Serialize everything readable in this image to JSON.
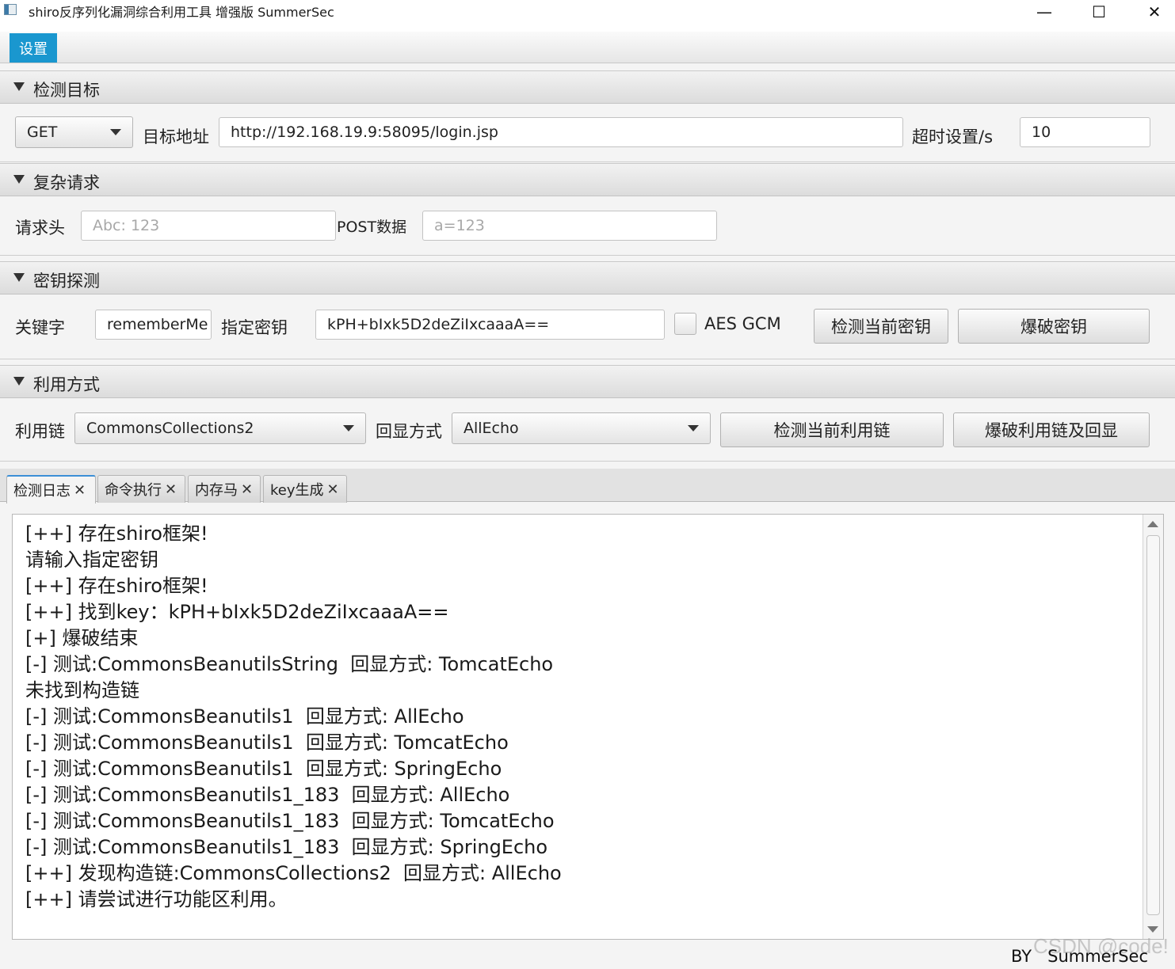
{
  "window": {
    "title": "shiro反序列化漏洞综合利用工具 增强版 SummerSec",
    "min_glyph": "—",
    "max_glyph": "☐",
    "close_glyph": "✕"
  },
  "menu": {
    "settings": "设置"
  },
  "target": {
    "title": "检测目标",
    "method": "GET",
    "url_label": "目标地址",
    "url": "http://192.168.19.9:58095/login.jsp",
    "timeout_label": "超时设置/s",
    "timeout": "10"
  },
  "complex": {
    "title": "复杂请求",
    "header_label": "请求头",
    "header_placeholder": "Abc: 123",
    "post_label": "POST数据",
    "post_placeholder": "a=123"
  },
  "key": {
    "title": "密钥探测",
    "keyword_label": "关键字",
    "keyword": "rememberMe",
    "specified_label": "指定密钥",
    "specified": "kPH+bIxk5D2deZiIxcaaaA==",
    "aes_gcm_label": "AES GCM",
    "check_button": "检测当前密钥",
    "brute_button": "爆破密钥"
  },
  "exploit": {
    "title": "利用方式",
    "chain_label": "利用链",
    "chain": "CommonsCollections2",
    "echo_label": "回显方式",
    "echo": "AllEcho",
    "check_button": "检测当前利用链",
    "brute_button": "爆破利用链及回显"
  },
  "tabs": [
    "检测日志",
    "命令执行",
    "内存马",
    "key生成"
  ],
  "tab_close": "✕",
  "log": [
    "[++] 存在shiro框架!",
    "请输入指定密钥",
    "[++] 存在shiro框架!",
    "[++] 找到key：kPH+bIxk5D2deZiIxcaaaA==",
    "[+] 爆破结束",
    "[-] 测试:CommonsBeanutilsString  回显方式: TomcatEcho",
    "未找到构造链",
    "[-] 测试:CommonsBeanutils1  回显方式: AllEcho",
    "[-] 测试:CommonsBeanutils1  回显方式: TomcatEcho",
    "[-] 测试:CommonsBeanutils1  回显方式: SpringEcho",
    "[-] 测试:CommonsBeanutils1_183  回显方式: AllEcho",
    "[-] 测试:CommonsBeanutils1_183  回显方式: TomcatEcho",
    "[-] 测试:CommonsBeanutils1_183  回显方式: SpringEcho",
    "[++] 发现构造链:CommonsCollections2  回显方式: AllEcho",
    "[++] 请尝试进行功能区利用。"
  ],
  "footer": "BY   SummerSec",
  "watermark": "CSDN @code!"
}
